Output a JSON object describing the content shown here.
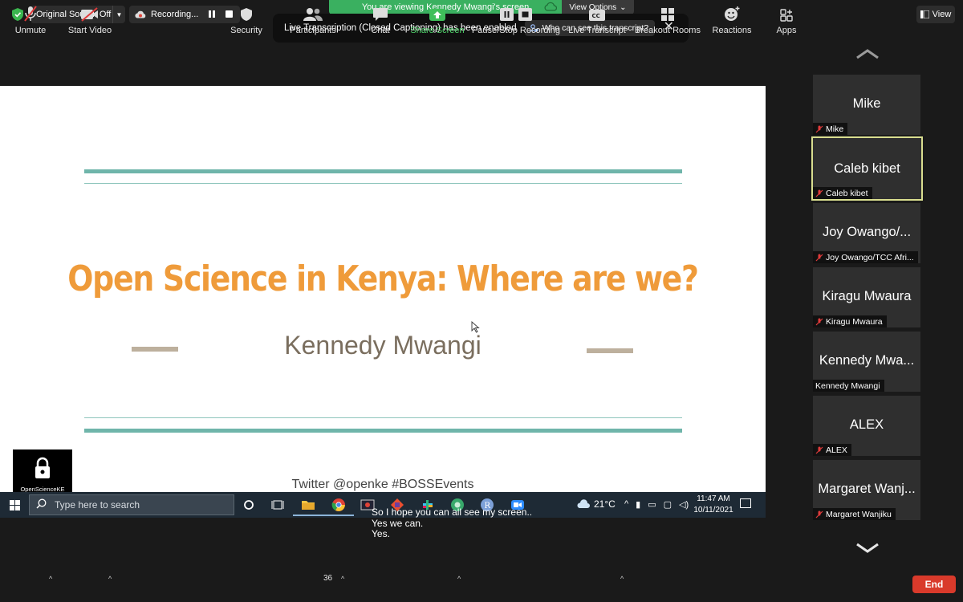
{
  "top_bar": {
    "original_sound": "Original Sound: Off",
    "recording": "Recording...",
    "viewing_banner": "You are viewing Kennedy Mwangi's screen",
    "view_options": "View Options",
    "view_button": "View"
  },
  "notice": {
    "message": "Live Transcription (Closed Captioning) has been enabled",
    "who_button": "Who can see this transcript?"
  },
  "slide": {
    "title": "Open Science in Kenya: Where are we?",
    "presenter": "Kennedy Mwangi",
    "footer": "Twitter @openke   #BOSSEvents",
    "logo_text": "OpenScienceKE",
    "colors": {
      "title": "#ef9b3a",
      "rules": "#6fb5aa",
      "subtitle": "#7a6e5e"
    }
  },
  "taskbar": {
    "search_placeholder": "Type here to search",
    "weather": "21°C",
    "time": "11:47 AM",
    "date": "10/11/2021"
  },
  "captions": [
    "So I hope you can all see my screen..",
    "Yes we can.",
    "Yes."
  ],
  "participants": [
    {
      "display": "Mike",
      "label": "Mike",
      "muted": true,
      "active": false
    },
    {
      "display": "Caleb kibet",
      "label": "Caleb kibet",
      "muted": true,
      "active": true
    },
    {
      "display": "Joy  Owango/...",
      "label": "Joy  Owango/TCC Afri...",
      "muted": true,
      "active": false
    },
    {
      "display": "Kiragu Mwaura",
      "label": "Kiragu Mwaura",
      "muted": true,
      "active": false
    },
    {
      "display": "Kennedy Mwa...",
      "label": "Kennedy Mwangi",
      "muted": false,
      "active": false
    },
    {
      "display": "ALEX",
      "label": "ALEX",
      "muted": true,
      "active": false
    },
    {
      "display": "Margaret Wanj...",
      "label": "Margaret Wanjiku",
      "muted": true,
      "active": false
    }
  ],
  "toolbar": {
    "unmute": "Unmute",
    "start_video": "Start Video",
    "security": "Security",
    "participants": "Participants",
    "participants_count": "36",
    "chat": "Chat",
    "share_screen": "Share Screen",
    "pause_stop_recording": "Pause/Stop Recording",
    "live_transcript": "Live Transcript",
    "breakout_rooms": "Breakout Rooms",
    "reactions": "Reactions",
    "apps": "Apps",
    "end": "End"
  }
}
